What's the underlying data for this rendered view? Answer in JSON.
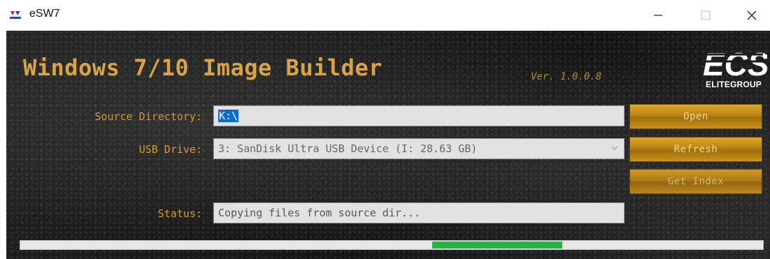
{
  "window": {
    "title": "eSW7",
    "controls": {
      "minimize_icon": "minimize-icon",
      "maximize_icon": "maximize-icon",
      "close_icon": "close-icon"
    }
  },
  "header": {
    "title": "Windows 7/10 Image Builder",
    "version": "Ver. 1.0.0.8",
    "logo_text": "ELITEGROUP",
    "logo_mark": "ECS"
  },
  "form": {
    "source_label": "Source Directory:",
    "source_value": "K:\\",
    "usb_label": "USB Drive:",
    "usb_value": "3: SanDisk Ultra USB Device (I: 28.63 GB)",
    "status_label": "Status:",
    "status_value": "Copying files from source dir..."
  },
  "buttons": {
    "open": "Open",
    "refresh": "Refresh",
    "get_index": "Get Index"
  },
  "progress": {
    "start_fraction": 0.555,
    "end_fraction": 0.73
  },
  "colors": {
    "accent_gold": "#d9a441",
    "button_gold": "#b98214",
    "progress_green": "#2ab24a",
    "selection_blue": "#0a6bd6"
  }
}
